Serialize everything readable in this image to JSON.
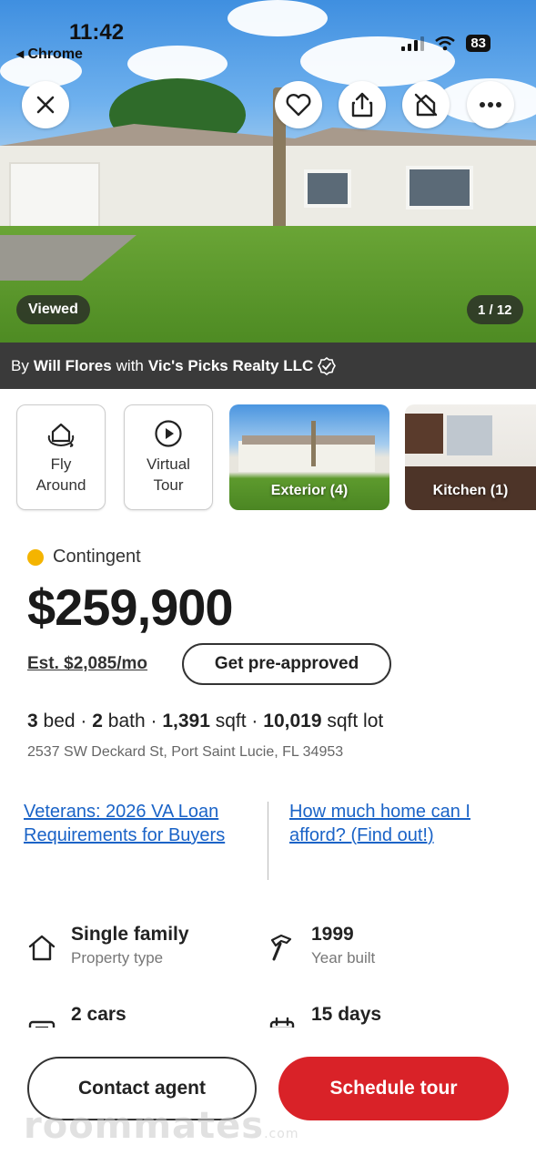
{
  "status_bar": {
    "time": "11:42",
    "back_app": "Chrome",
    "battery": "83"
  },
  "hero": {
    "viewed_badge": "Viewed",
    "photo_counter": "1 / 12"
  },
  "agent_bar": {
    "by": "By",
    "agent": "Will Flores",
    "with": "with",
    "brokerage": "Vic's Picks Realty LLC"
  },
  "media": {
    "fly_around": [
      "Fly",
      "Around"
    ],
    "virtual_tour": [
      "Virtual",
      "Tour"
    ],
    "exterior": "Exterior (4)",
    "kitchen": "Kitchen (1)"
  },
  "listing": {
    "status": "Contingent",
    "status_color": "#f4b400",
    "price": "$259,900",
    "est_payment": "Est. $2,085/mo",
    "preapproved_label": "Get pre-approved",
    "beds": "3",
    "beds_label": "bed",
    "baths": "2",
    "baths_label": "bath",
    "sqft": "1,391",
    "sqft_label": "sqft",
    "lot": "10,019",
    "lot_label": "sqft lot",
    "address": "2537 SW Deckard St, Port Saint Lucie, FL 34953"
  },
  "links": {
    "va_loan": [
      "Veterans: 2026 VA Loan",
      "Requirements for Buyers"
    ],
    "afford": [
      "How much home can I",
      "afford? (Find out!)"
    ]
  },
  "details": [
    {
      "value": "Single family",
      "label": "Property type",
      "icon": "house-icon"
    },
    {
      "value": "1999",
      "label": "Year built",
      "icon": "hammer-icon"
    },
    {
      "value": "2 cars",
      "label": "",
      "icon": "garage-icon"
    },
    {
      "value": "15 days",
      "label": "",
      "icon": "calendar-icon"
    }
  ],
  "actions": {
    "contact": "Contact agent",
    "tour": "Schedule tour"
  },
  "watermark": {
    "text": "roommates",
    "suffix": ".com"
  }
}
